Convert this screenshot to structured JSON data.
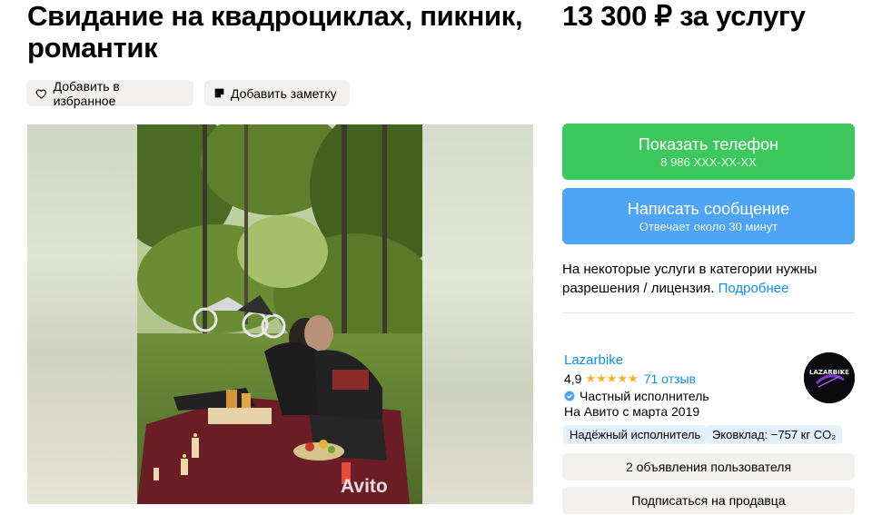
{
  "listing": {
    "title": "Свидание на квадроциклах, пикник, романтик",
    "price": "13 300 ₽ за услугу"
  },
  "actions": {
    "favorite_label": "Добавить в избранное",
    "note_label": "Добавить заметку"
  },
  "gallery": {
    "watermark": "Avito"
  },
  "contact": {
    "phone_label": "Показать телефон",
    "phone_masked": "8 986 XXX-XX-XX",
    "message_label": "Написать сообщение",
    "message_sub": "Отвечает около 30 минут"
  },
  "notice": {
    "text": "На некоторые услуги в категории нужны разрешения / лицензия.",
    "link": "Подробнее"
  },
  "seller": {
    "name": "Lazarbike",
    "rating": "4,9",
    "stars": "★★★★★",
    "reviews": "71 отзыв",
    "type": "Частный исполнитель",
    "since": "На Авито с марта 2019",
    "avatar_text": "LAZARBIKE",
    "badges": [
      "Надёжный исполнитель",
      "Эковклад: −757 кг CO₂"
    ],
    "ads_button": "2 объявления пользователя",
    "subscribe_button": "Подписаться на продавца"
  },
  "colors": {
    "green": "#3dc85e",
    "blue": "#4ea5f7",
    "link": "#0a8ef0",
    "star": "#ffb020"
  }
}
